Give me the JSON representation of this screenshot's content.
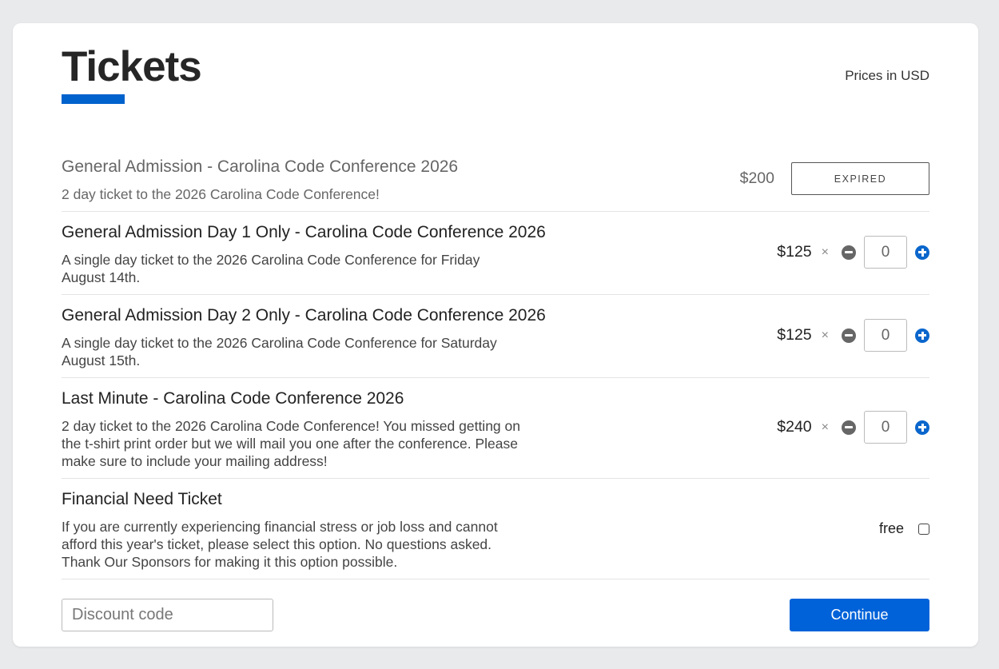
{
  "header": {
    "title": "Tickets",
    "prices_note": "Prices in USD",
    "accent_color": "#0062cc"
  },
  "tickets": [
    {
      "name": "General Admission - Carolina Code Conference 2026",
      "description": "2 day ticket to the 2026 Carolina Code Conference!",
      "price": "$200",
      "status": "EXPIRED"
    },
    {
      "name": "General Admission Day 1 Only - Carolina Code Conference 2026",
      "description": "A single day ticket to the 2026 Carolina Code Conference for Friday August 14th.",
      "price": "$125",
      "times": "×",
      "quantity": "0"
    },
    {
      "name": "General Admission Day 2 Only - Carolina Code Conference 2026",
      "description": "A single day ticket to the 2026 Carolina Code Conference for Saturday August 15th.",
      "price": "$125",
      "times": "×",
      "quantity": "0"
    },
    {
      "name": "Last Minute - Carolina Code Conference 2026",
      "description": "2 day ticket to the 2026 Carolina Code Conference! You missed getting on the t-shirt print order but we will mail you one after the conference. Please make sure to include your mailing address!",
      "price": "$240",
      "times": "×",
      "quantity": "0"
    },
    {
      "name": "Financial Need Ticket",
      "description": "If you are currently experiencing financial stress or job loss and cannot afford this year's ticket, please select this option. No questions asked. Thank Our Sponsors for making it this option possible.",
      "price": "free",
      "checked": false
    }
  ],
  "footer": {
    "discount_placeholder": "Discount code",
    "continue_label": "Continue"
  },
  "icons": {
    "minus": "minus-circle-icon",
    "plus": "plus-circle-icon"
  }
}
